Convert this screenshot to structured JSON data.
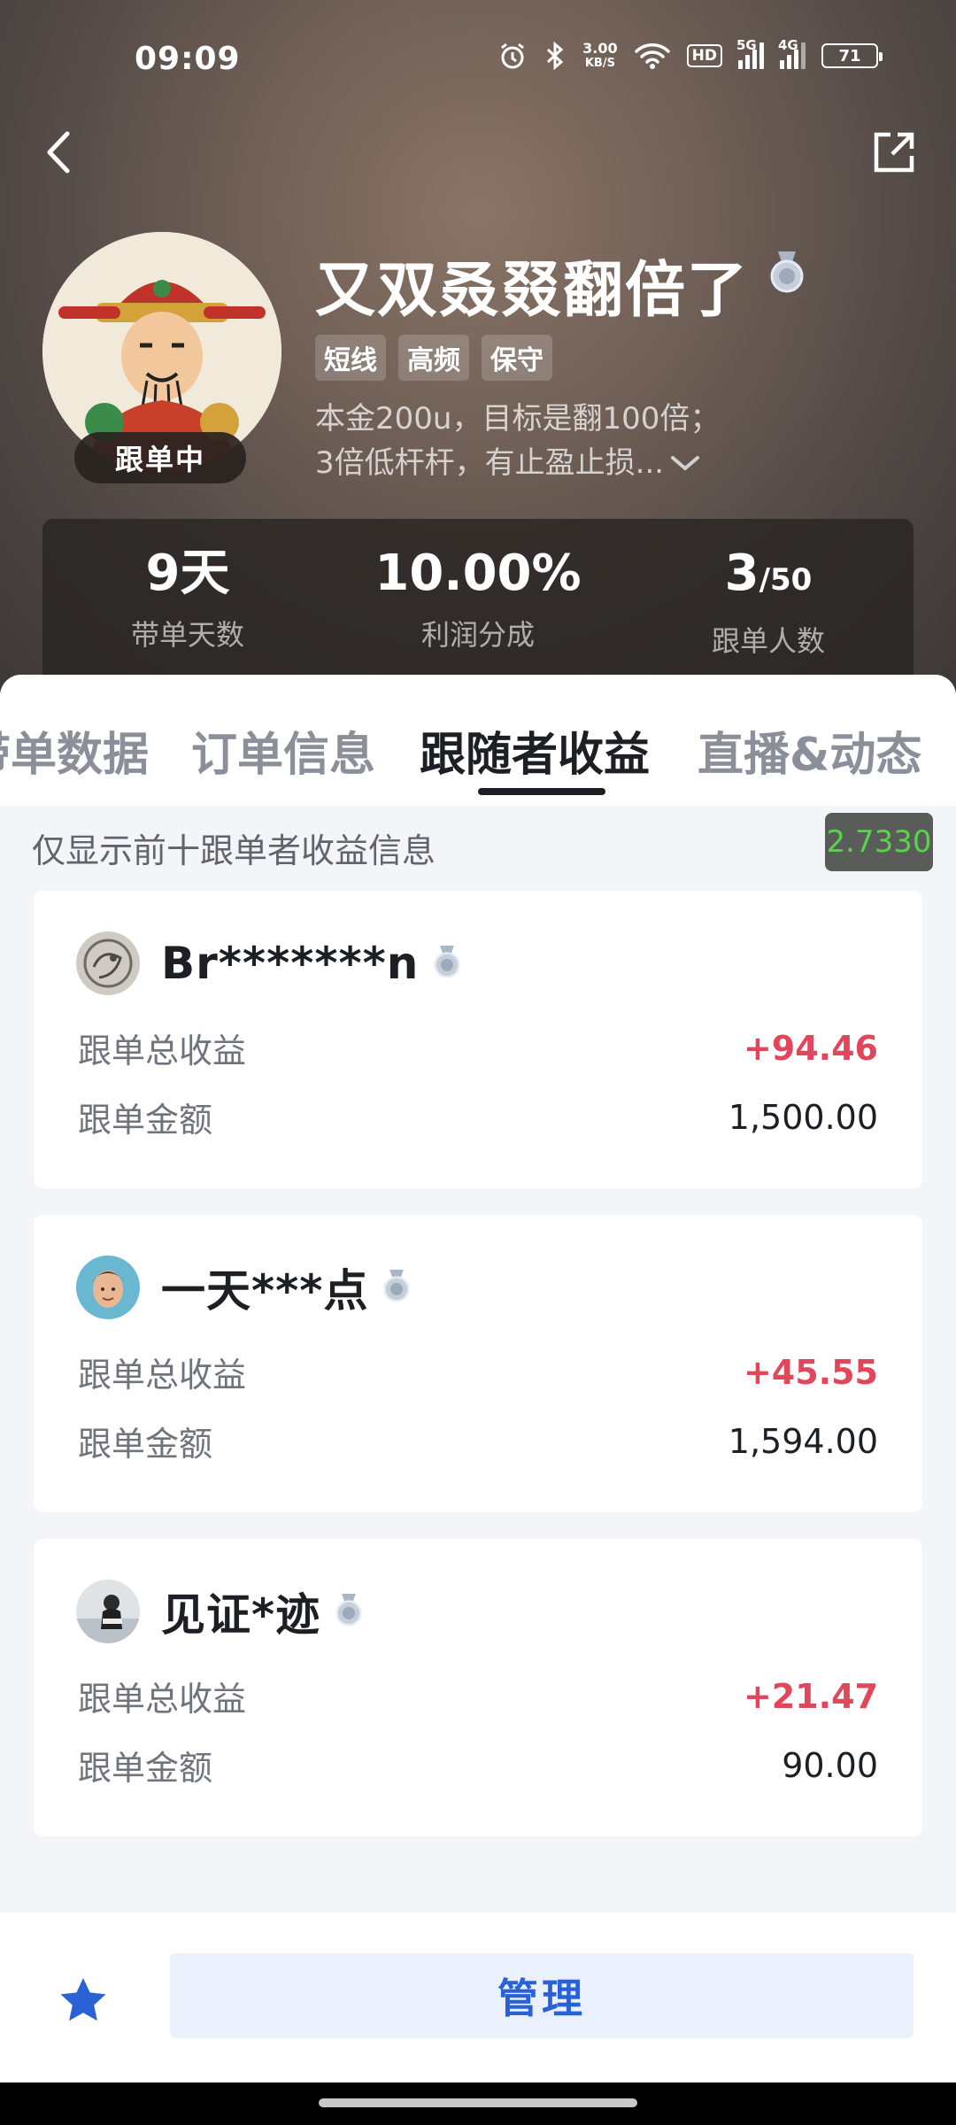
{
  "status_bar": {
    "time": "09:09",
    "net_speed_value": "3.00",
    "net_speed_unit": "KB/S",
    "hd": "HD",
    "sig1_label": "5G",
    "sig2_label": "4G",
    "battery": "71",
    "icons": [
      "alarm-icon",
      "bluetooth-icon",
      "wifi-icon",
      "signal-icon",
      "battery-icon"
    ]
  },
  "header": {
    "trader_name": "又双叒叕翻倍了",
    "follow_status": "跟单中",
    "tags": [
      "短线",
      "高频",
      "保守"
    ],
    "bio_line1": "本金200u，目标是翻100倍；",
    "bio_line2": "3倍低杆杆，有止盈止损..."
  },
  "stats": [
    {
      "value": "9天",
      "label": "带单天数"
    },
    {
      "value": "10.00%",
      "label": "利润分成"
    },
    {
      "value_main": "3",
      "value_sub": "/50",
      "label": "跟单人数"
    }
  ],
  "tabs": {
    "t1": "带单数据",
    "t2": "订单信息",
    "t3": "跟随者收益",
    "t4": "直播&动态",
    "active": "跟随者收益"
  },
  "notice": "仅显示前十跟单者收益信息",
  "float_badge": "2.7330",
  "followers": [
    {
      "name": "Br*******n",
      "profit_label": "跟单总收益",
      "profit": "+94.46",
      "amount_label": "跟单金额",
      "amount": "1,500.00"
    },
    {
      "name": "一天***点",
      "profit_label": "跟单总收益",
      "profit": "+45.55",
      "amount_label": "跟单金额",
      "amount": "1,594.00"
    },
    {
      "name": "见证*迹",
      "profit_label": "跟单总收益",
      "profit": "+21.47",
      "amount_label": "跟单金额",
      "amount": "90.00"
    }
  ],
  "bottom": {
    "manage_label": "管理"
  },
  "colors": {
    "profit": "#e0475a",
    "accent": "#2a62d6",
    "badge_text": "#58d34a"
  }
}
